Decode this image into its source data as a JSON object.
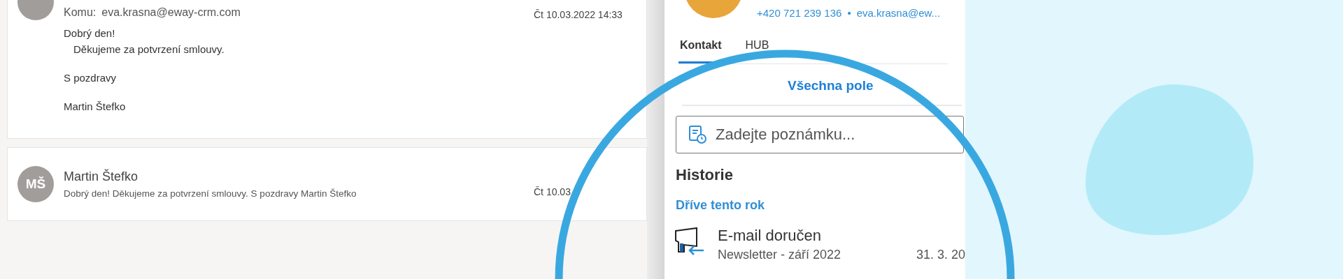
{
  "emails": [
    {
      "to_label": "Komu:",
      "to": "eva.krasna@eway-crm.com",
      "date": "Čt 10.03.2022 14:33",
      "body": [
        [
          "Dobrý den!",
          "Děkujeme za potvrzení smlouvy."
        ],
        [
          "S pozdravy"
        ],
        [
          "Martin Štefko"
        ]
      ]
    },
    {
      "avatar": "MŠ",
      "sender": "Martin Štefko",
      "preview": "Dobrý den! Děkujeme za potvrzení smlouvy. S pozdravy Martin Štefko",
      "date": "Čt 10.03"
    }
  ],
  "contact": {
    "phone": "+420 721 239 136",
    "separator": "•",
    "email": "eva.krasna@ew...",
    "tabs": [
      {
        "label": "Kontakt",
        "selected": true
      },
      {
        "label": "HUB",
        "selected": false
      }
    ],
    "all_fields_link": "Všechna pole",
    "note_field": {
      "placeholder": "Zadejte poznámku..."
    },
    "history": {
      "title": "Historie",
      "groups": [
        {
          "title": "Dříve tento rok",
          "items": [
            {
              "title": "E-mail doručen",
              "subtitle": "Newsletter - září 2022",
              "date": "31. 3. 20"
            }
          ]
        }
      ]
    }
  }
}
